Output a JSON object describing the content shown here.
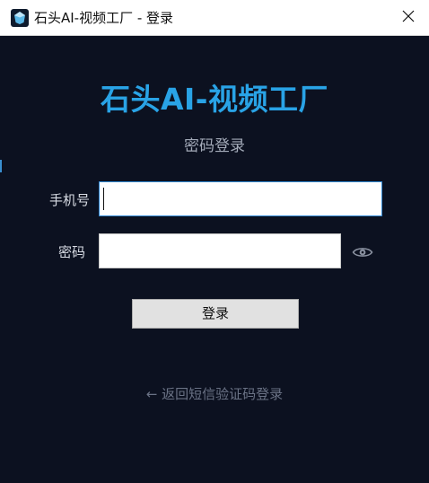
{
  "window": {
    "title": "石头AI-视频工厂 - 登录",
    "close_glyph": "✕",
    "icon": "app-logo-icon"
  },
  "colors": {
    "background": "#0c1120",
    "brand": "#29a3e6",
    "focus_border": "#2f86d1",
    "muted_text": "#6a7285"
  },
  "login": {
    "brand_title": "石头AI-视频工厂",
    "subtitle": "密码登录",
    "phone_label": "手机号",
    "phone_value": "",
    "password_label": "密码",
    "password_value": "",
    "password_toggle_icon": "eye-icon",
    "submit_label": "登录",
    "back_link": "← 返回短信验证码登录"
  }
}
